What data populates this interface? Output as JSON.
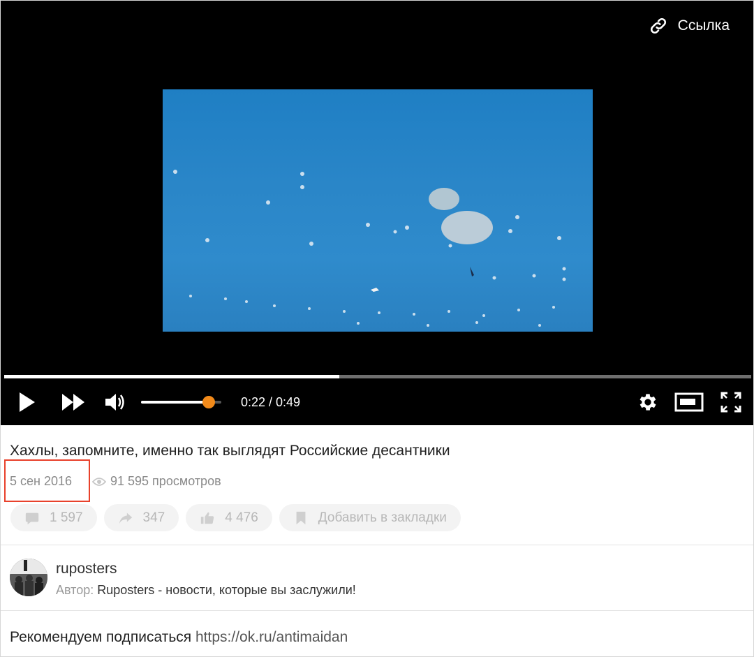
{
  "player": {
    "link_label": "Ссылка",
    "time_display": "0:22 / 0:49",
    "progress_fraction": 0.449,
    "volume_fraction": 0.84,
    "accent_color": "#f28a1a",
    "icons": [
      "link-icon",
      "play-icon",
      "fast-forward-icon",
      "volume-icon",
      "settings-icon",
      "mini-player-icon",
      "fullscreen-icon"
    ]
  },
  "video": {
    "title": "Хахлы, запомните, именно так выглядят Российские десантники",
    "date": "5 сен 2016",
    "views": "91 595 просмотров"
  },
  "actions": {
    "comments": "1 597",
    "shares": "347",
    "likes": "4 476",
    "bookmark": "Добавить в закладки"
  },
  "channel": {
    "name": "ruposters",
    "author_label": "Автор:",
    "author_value": "Ruposters - новости, которые вы заслужили!"
  },
  "description": {
    "text": "Рекомендуем подписаться",
    "link": "https://ok.ru/antimaidan"
  },
  "highlight_color": "#e8412b"
}
